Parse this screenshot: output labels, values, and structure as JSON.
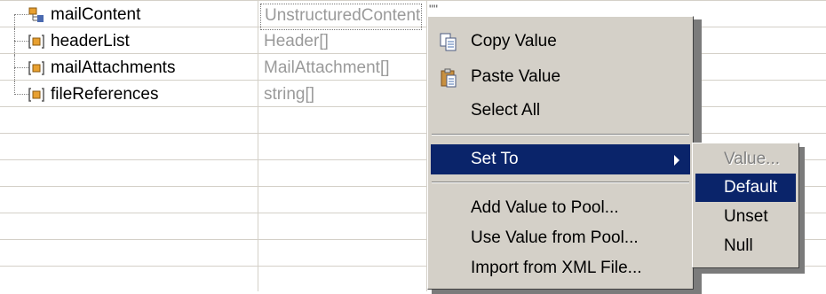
{
  "tree": {
    "rows": [
      {
        "name": "mailContent",
        "type": "UnstructuredContent",
        "icon": "complex-type-icon"
      },
      {
        "name": "headerList",
        "type": "Header[]",
        "icon": "array-field-icon"
      },
      {
        "name": "mailAttachments",
        "type": "MailAttachment[]",
        "icon": "array-field-icon"
      },
      {
        "name": "fileReferences",
        "type": "string[]",
        "icon": "array-field-icon"
      }
    ],
    "value_fragment": "\"\""
  },
  "context_menu": {
    "copy_value": "Copy Value",
    "paste_value": "Paste Value",
    "select_all": "Select All",
    "set_to": "Set To",
    "add_value_to_pool": "Add Value to Pool...",
    "use_value_from_pool": "Use Value from Pool...",
    "import_from_xml": "Import from XML File..."
  },
  "submenu": {
    "value": "Value...",
    "default": "Default",
    "unset": "Unset",
    "null": "Null"
  },
  "colors": {
    "highlight": "#0a246a",
    "menu_bg": "#d4d0c8",
    "grid": "#d4d0c8",
    "type_text": "#9a9a9a",
    "icon_orange": "#e8a030"
  }
}
